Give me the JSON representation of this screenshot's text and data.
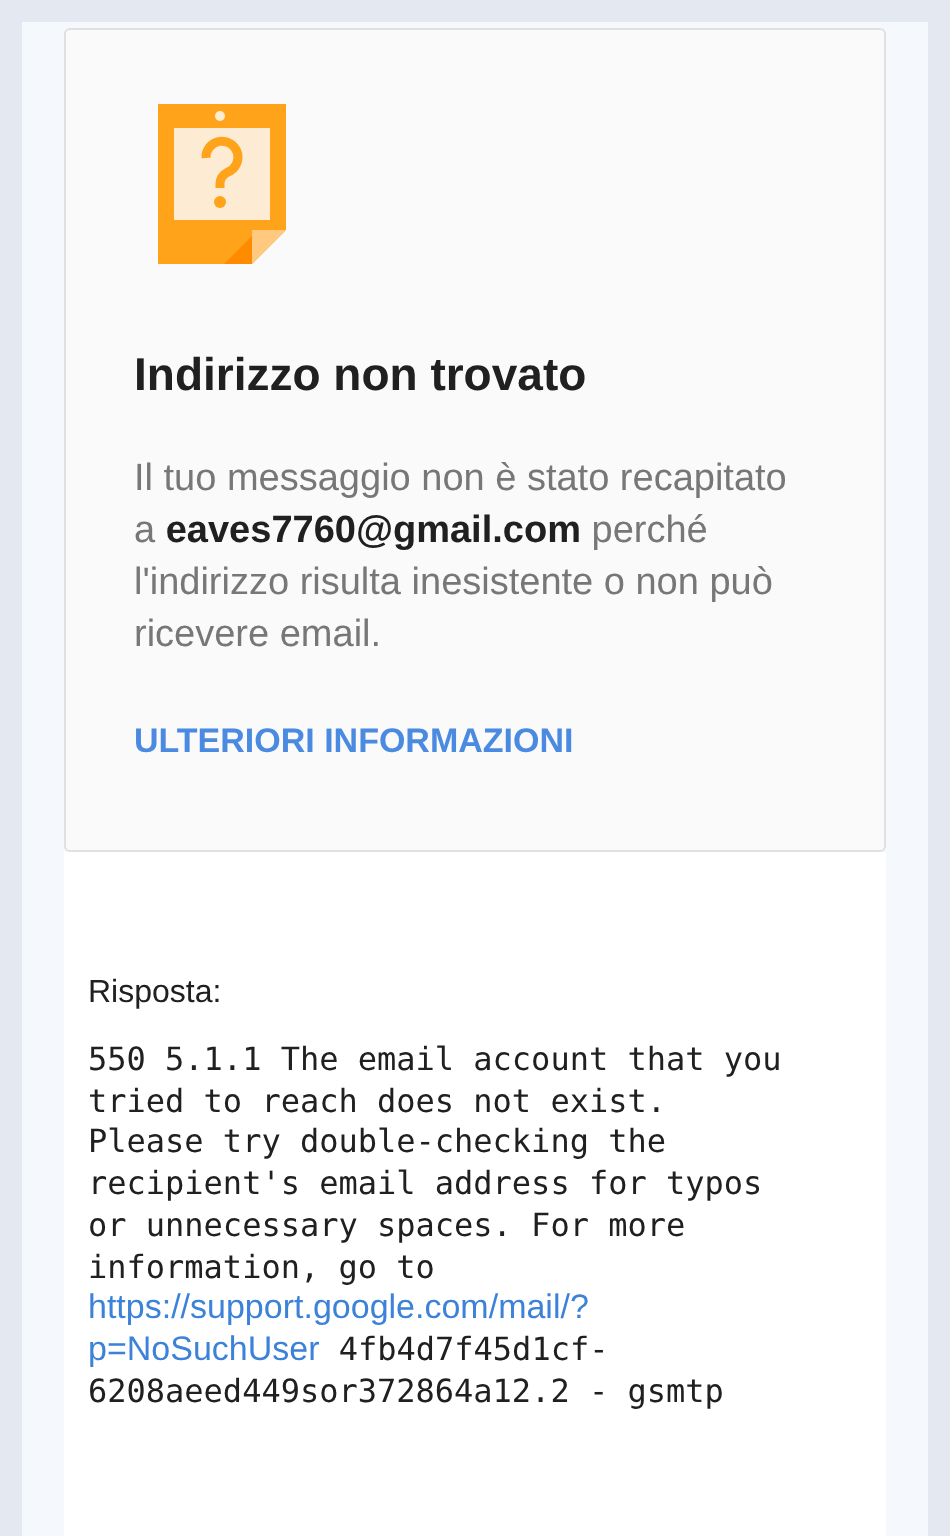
{
  "card": {
    "title": "Indirizzo non trovato",
    "message": "Il tuo messaggio non è stato recapitato a **eaves7760@gmail.com** perché l'indirizzo risulta inesistente o non può ricevere email.",
    "link": "ULTERIORI INFORMAZIONI"
  },
  "response": {
    "label": "Risposta:",
    "lines": [
      [
        {
          "kind": "text",
          "text": "550 5.1.1 The email account that you"
        }
      ],
      [
        {
          "kind": "text",
          "text": "tried to reach does not exist."
        }
      ],
      [
        {
          "kind": "text",
          "text": "Please try double-checking the"
        }
      ],
      [
        {
          "kind": "text",
          "text": "recipient's email address for typos"
        }
      ],
      [
        {
          "kind": "text",
          "text": "or unnecessary spaces. For more"
        }
      ],
      [
        {
          "kind": "text",
          "text": "information, go to"
        }
      ],
      [
        {
          "kind": "link",
          "text": "https://support.google.com/mail/?"
        }
      ],
      [
        {
          "kind": "link",
          "text": "p=NoSuchUser"
        },
        {
          "kind": "text",
          "text": "4fb4d7f45d1cf-"
        }
      ],
      [
        {
          "kind": "text",
          "text": "6208aeed449sor372864a12.2 - gsmtp"
        }
      ]
    ]
  }
}
